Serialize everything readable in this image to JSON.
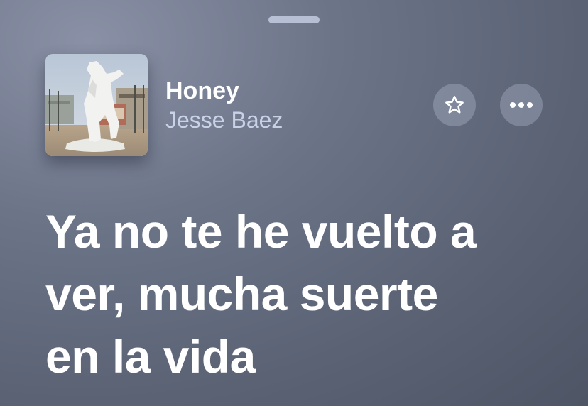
{
  "now_playing": {
    "title": "Honey",
    "artist": "Jesse Baez"
  },
  "buttons": {
    "favorite_icon": "star-icon",
    "more_icon": "ellipsis-icon"
  },
  "lyrics": {
    "current_lines": [
      "Ya no te he vuelto a",
      "ver, mucha suerte",
      "en la vida"
    ]
  },
  "colors": {
    "background": "#6c7488",
    "text_primary": "#ffffff",
    "text_secondary": "#d7e1f5"
  }
}
